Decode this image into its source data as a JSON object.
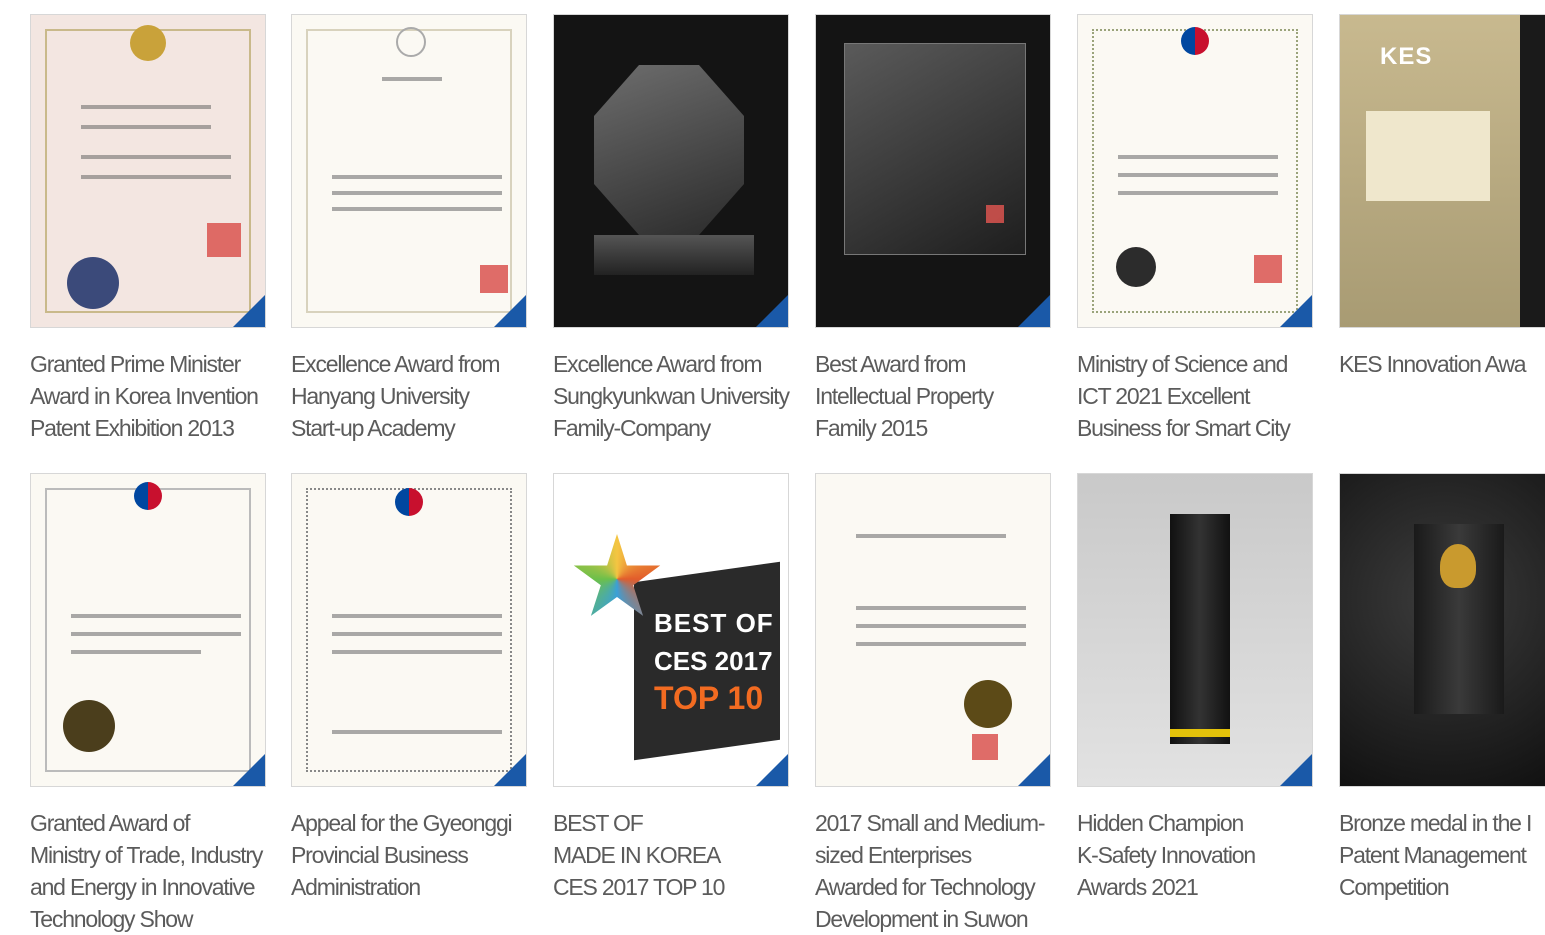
{
  "awards": [
    {
      "caption": "Granted Prime Minister\nAward in Korea Invention\nPatent Exhibition 2013"
    },
    {
      "caption": "Excellence Award from\nHanyang University\nStart-up Academy"
    },
    {
      "caption": "Excellence Award from\nSungkyunkwan University\nFamily-Company"
    },
    {
      "caption": "Best Award from\nIntellectual Property\nFamily 2015"
    },
    {
      "caption": "Ministry of Science and\nICT 2021 Excellent\nBusiness for Smart City"
    },
    {
      "caption": "KES Innovation Awa"
    },
    {
      "caption": "Granted Award of\nMinistry of Trade, Industry\nand Energy in Innovative\nTechnology Show"
    },
    {
      "caption": "Appeal for the Gyeonggi\nProvincial Business\nAdministration"
    },
    {
      "caption": "BEST OF\nMADE IN KOREA\nCES 2017 TOP 10"
    },
    {
      "caption": "2017 Small and Medium-\nsized Enterprises\nAwarded for Technology\nDevelopment in Suwon"
    },
    {
      "caption": "Hidden Champion\nK-Safety Innovation\nAwards 2021"
    },
    {
      "caption": "Bronze medal in the I\nPatent Management\nCompetition"
    }
  ],
  "images": {
    "kes_logo": "KES",
    "ces_line1": "BEST OF",
    "ces_line2": "CES 2017",
    "ces_line3": "TOP 10"
  },
  "colors": {
    "corner_accent": "#1a59a8",
    "caption_text": "#5b5b5b"
  }
}
